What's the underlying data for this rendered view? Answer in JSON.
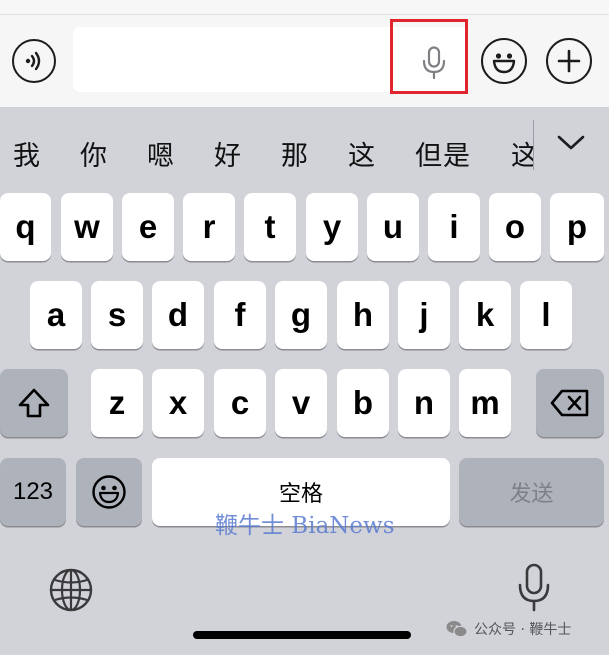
{
  "input_bar": {
    "voice_toggle_icon": "voice-wave-icon",
    "text_value": "",
    "mic_icon": "microphone-icon",
    "emoji_icon": "emoji-face-icon",
    "add_icon": "plus-icon",
    "highlight_color": "#e0262c"
  },
  "candidates": {
    "items": [
      "我",
      "你",
      "嗯",
      "好",
      "那",
      "这",
      "但是",
      "这"
    ],
    "expand_icon": "chevron-down-icon"
  },
  "keyboard": {
    "row1": [
      "q",
      "w",
      "e",
      "r",
      "t",
      "y",
      "u",
      "i",
      "o",
      "p"
    ],
    "row2": [
      "a",
      "s",
      "d",
      "f",
      "g",
      "h",
      "j",
      "k",
      "l"
    ],
    "row3": [
      "z",
      "x",
      "c",
      "v",
      "b",
      "n",
      "m"
    ],
    "shift_icon": "shift-arrow-icon",
    "delete_icon": "delete-backspace-icon",
    "numbers_label": "123",
    "emoji_icon": "emoji-face-icon",
    "space_label": "空格",
    "send_label": "发送"
  },
  "bottom": {
    "globe_icon": "globe-icon",
    "dictation_icon": "microphone-icon"
  },
  "watermark": "鞭牛士 BiaNews",
  "footer_brand": "公众号 · 鞭牛士"
}
